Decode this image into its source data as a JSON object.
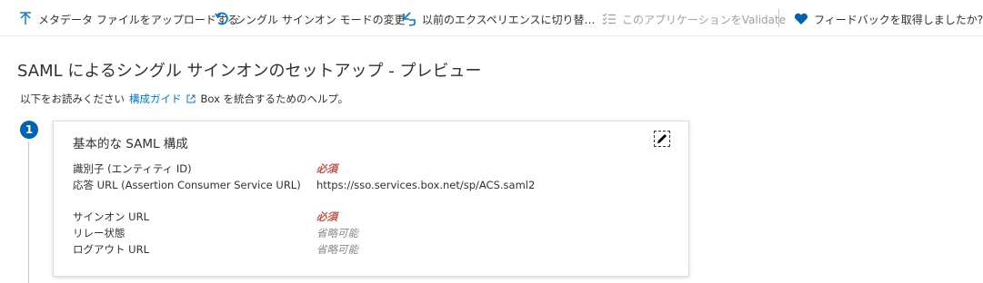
{
  "toolbar": {
    "items": [
      {
        "label": "メタデータ ファイルをアップロードする",
        "icon": "upload-icon"
      },
      {
        "label": "シングル サインオン モードの変更",
        "icon": "undo-icon"
      },
      {
        "label": "以前のエクスペリエンスに切り替…",
        "icon": "switch-arrows-icon"
      },
      {
        "label": "このアプリケーションをValidate",
        "icon": "checklist-icon",
        "disabled": true
      },
      {
        "label": "フィードバックを取得しましたか?",
        "icon": "heart-icon"
      }
    ]
  },
  "page": {
    "title": "SAML によるシングル サインオンのセットアップ - プレビュー",
    "help_prefix": "以下をお読みください",
    "help_link": "構成ガイド",
    "help_suffix": "Box を統合するためのヘルプ。"
  },
  "step": {
    "number": "1",
    "card_title": "基本的な SAML 構成",
    "fields": [
      {
        "label": "識別子 (エンティティ ID)",
        "value": "必須",
        "status": "required"
      },
      {
        "label": "応答 URL (Assertion Consumer Service URL)",
        "value": "https://sso.services.box.net/sp/ACS.saml2",
        "status": "value"
      },
      {
        "label": "サインオン URL",
        "value": "必須",
        "status": "required"
      },
      {
        "label": "リレー状態",
        "value": "省略可能",
        "status": "optional"
      },
      {
        "label": "ログアウト URL",
        "value": "省略可能",
        "status": "optional"
      }
    ]
  },
  "colors": {
    "accent": "#0078d4",
    "step_circle": "#0063b1",
    "required": "#c5534b",
    "optional": "#8a8886",
    "disabled": "#a19f9d"
  }
}
